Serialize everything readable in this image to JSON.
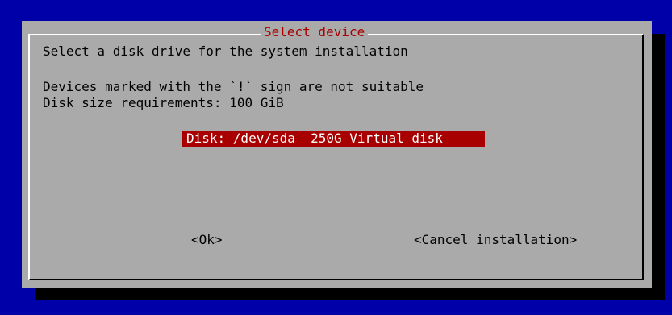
{
  "dialog": {
    "title": "Select device",
    "prompt": "Select a disk drive for the system installation",
    "note_unsuitable": "Devices marked with the `!` sign are not suitable",
    "requirements": "Disk size requirements: 100 GiB"
  },
  "devices": [
    {
      "label": "Disk: /dev/sda  250G Virtual disk",
      "selected": true
    }
  ],
  "buttons": {
    "ok": "<Ok>",
    "cancel": "<Cancel installation>"
  },
  "colors": {
    "background": "#0000a8",
    "dialog": "#aaaaaa",
    "highlight": "#a80000",
    "title_text": "#a80000"
  }
}
